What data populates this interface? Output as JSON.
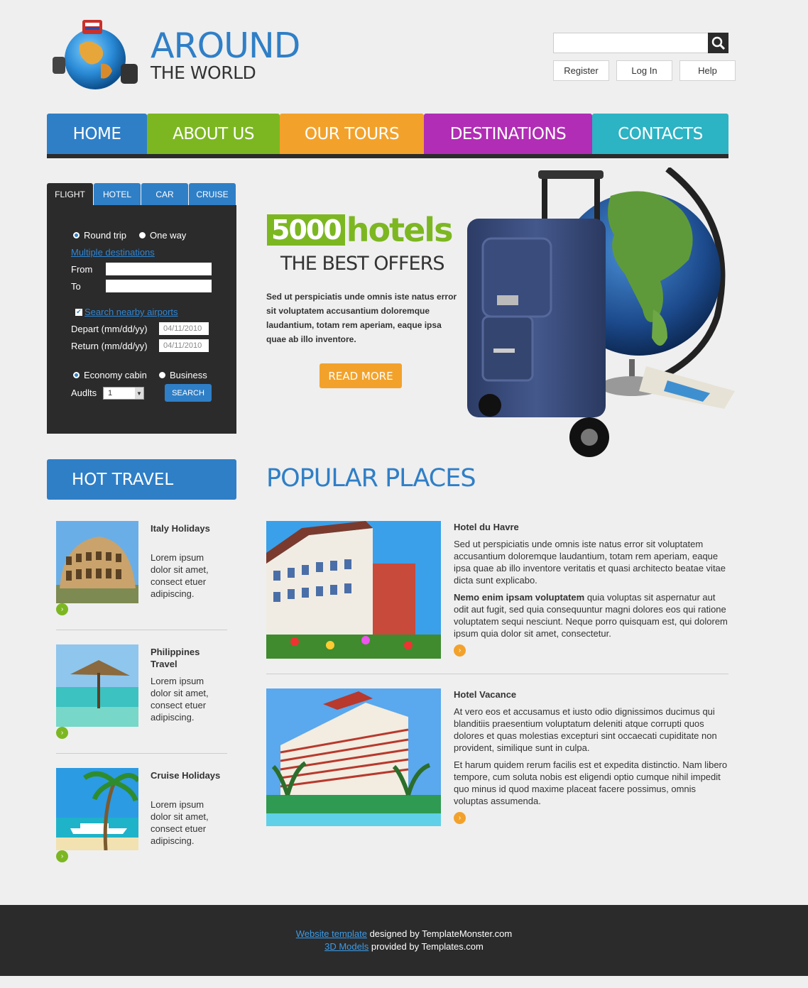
{
  "header": {
    "logo_title": "AROUND",
    "logo_subtitle": "THE WORLD",
    "search_placeholder": "",
    "links": [
      "Register",
      "Log In",
      "Help"
    ]
  },
  "nav": [
    {
      "label": "HOME",
      "color": "#2f7fc7"
    },
    {
      "label": "ABOUT US",
      "color": "#7cb721"
    },
    {
      "label": "OUR TOURS",
      "color": "#f2a22b"
    },
    {
      "label": "DESTINATIONS",
      "color": "#b12db5"
    },
    {
      "label": "CONTACTS",
      "color": "#2cb3c4"
    }
  ],
  "booking": {
    "tabs": [
      "FLIGHT",
      "HOTEL",
      "CAR",
      "CRUISE"
    ],
    "active_tab": "FLIGHT",
    "trip_options": [
      "Round trip",
      "One way"
    ],
    "selected_trip": "Round trip",
    "multiple_link": "Multiple destinations",
    "from_label": "From",
    "to_label": "To",
    "nearby_label": "Search nearby airports",
    "nearby_checked": true,
    "depart_label": "Depart (mm/dd/yy)",
    "depart_value": "04/11/2010",
    "return_label": "Return (mm/dd/yy)",
    "return_value": "04/11/2010",
    "cabin_options": [
      "Economy cabin",
      "Business"
    ],
    "selected_cabin": "Economy cabin",
    "adults_label": "Audlts",
    "adults_value": "1",
    "search_button": "SEARCH"
  },
  "hero": {
    "number": "5000",
    "word": "hotels",
    "subtitle": "THE BEST OFFERS",
    "text": "Sed ut perspiciatis unde omnis iste natus error sit voluptatem accusantium doloremque laudantium, totam rem aperiam, eaque ipsa quae ab illo inventore.",
    "button": "READ MORE"
  },
  "hot_travel": {
    "heading": "HOT TRAVEL",
    "items": [
      {
        "title": "Italy Holidays",
        "desc": "Lorem ipsum dolor sit amet, consect etuer adipiscing."
      },
      {
        "title": "Philippines Travel",
        "desc": "Lorem ipsum dolor sit amet, consect etuer adipiscing."
      },
      {
        "title": "Cruise Holidays",
        "desc": "Lorem ipsum dolor sit amet, consect etuer adipiscing."
      }
    ]
  },
  "popular": {
    "heading": "POPULAR PLACES",
    "places": [
      {
        "title": "Hotel du Havre",
        "p1": "Sed ut perspiciatis unde omnis iste natus error sit voluptatem accusantium doloremque laudantium, totam rem aperiam, eaque ipsa quae ab illo inventore veritatis et quasi architecto beatae vitae dicta sunt explicabo.",
        "p2_bold": "Nemo enim ipsam voluptatem",
        "p2_rest": " quia voluptas sit aspernatur aut odit aut fugit, sed quia consequuntur magni dolores eos qui ratione voluptatem sequi nesciunt. Neque porro quisquam est, qui dolorem ipsum quia dolor sit amet, consectetur."
      },
      {
        "title": "Hotel Vacance",
        "p1": "At vero eos et accusamus et iusto odio dignissimos ducimus qui blanditiis praesentium voluptatum deleniti atque corrupti quos dolores et quas molestias excepturi sint occaecati cupiditate non provident, similique sunt in culpa.",
        "p2_bold": "",
        "p2_rest": "Et harum quidem rerum facilis est et expedita distinctio. Nam libero tempore, cum soluta nobis est eligendi optio cumque nihil impedit quo minus id quod maxime placeat facere possimus, omnis voluptas assumenda."
      }
    ]
  },
  "footer": {
    "link1": "Website template",
    "text1": " designed by TemplateMonster.com",
    "link2": "3D Models",
    "text2": " provided by Templates.com"
  }
}
